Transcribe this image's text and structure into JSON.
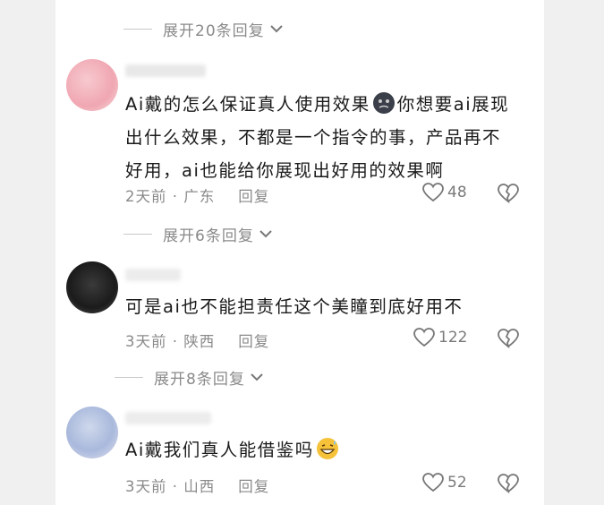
{
  "thread": {
    "expand_top": "展开20条回复",
    "comments": [
      {
        "text_lines": [
          "Ai戴的怎么保证真人使用效果",
          "你想要ai展现",
          "出什么效果，不都是一个指令的事，产品再不",
          "好用，ai也能给你展现出好用的效果啊"
        ],
        "time": "2天前",
        "region": "广东",
        "reply_label": "回复",
        "likes": "48",
        "emoji_icon": "dark-face-emoji-icon",
        "expand_label": "展开6条回复"
      },
      {
        "text_lines": [
          "可是ai也不能担责任这个美瞳到底好用不"
        ],
        "time": "3天前",
        "region": "陕西",
        "reply_label": "回复",
        "likes": "122",
        "expand_label": "展开8条回复"
      },
      {
        "text_lines": [
          "Ai戴我们真人能借鉴吗"
        ],
        "time": "3天前",
        "region": "山西",
        "reply_label": "回复",
        "likes": "52",
        "emoji_icon": "grinning-sweat-emoji-icon"
      }
    ]
  },
  "colors": {
    "text": "#1a1a1a",
    "meta": "#8a8a8a",
    "background": "#ffffff"
  }
}
